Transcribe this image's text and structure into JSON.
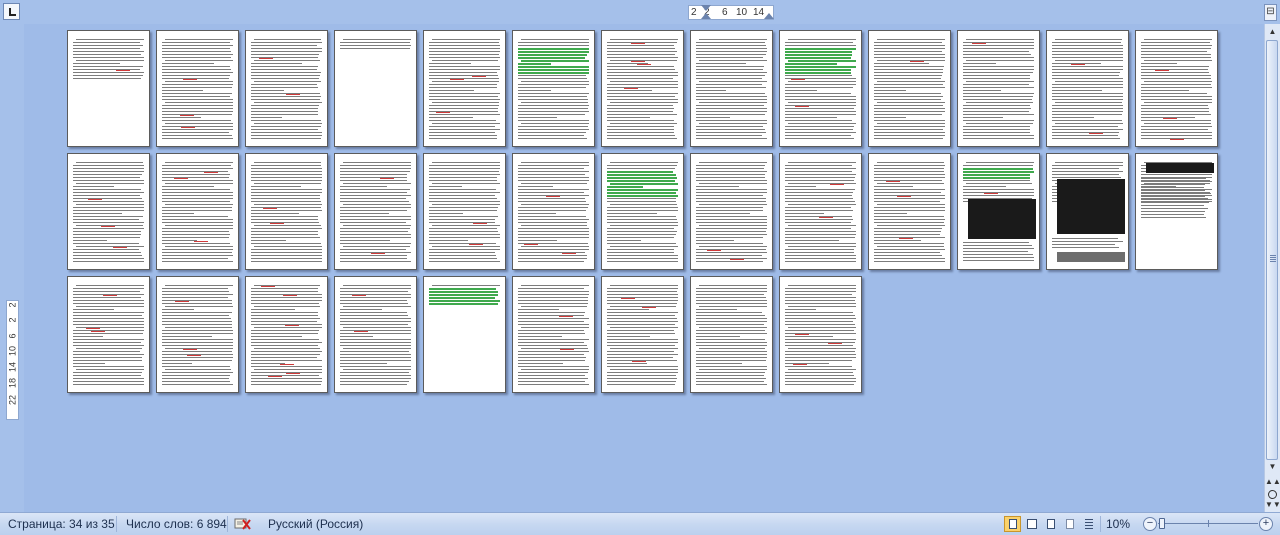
{
  "status_bar": {
    "page_label": "Страница: 34 из 35",
    "word_count_label": "Число слов: 6 894",
    "language_label": "Русский (Россия)",
    "zoom_label": "10%",
    "zoom_out_symbol": "−",
    "zoom_in_symbol": "+",
    "zoom_percent": 10,
    "active_view": "print-layout"
  },
  "horizontal_ruler": {
    "ticks": [
      "2",
      "2",
      "6",
      "10",
      "14"
    ]
  },
  "vertical_ruler": {
    "ticks": [
      "2",
      "2",
      "6",
      "10",
      "14",
      "18",
      "22"
    ]
  },
  "scrollbar": {
    "up_symbol": "▲",
    "down_symbol": "▼",
    "prev_symbol": "▲▲",
    "next_symbol": "▼▼"
  },
  "view_ruler_symbol": "⊟",
  "document": {
    "page_count": 35,
    "current_page": 34,
    "page_kinds": [
      "toc",
      "text",
      "text",
      "blank-ish",
      "text",
      "green",
      "text",
      "text",
      "green",
      "text",
      "text",
      "text",
      "text",
      "text",
      "text",
      "text",
      "text",
      "text",
      "text",
      "green",
      "text",
      "text",
      "text",
      "table",
      "table",
      "table",
      "text",
      "text",
      "text",
      "text",
      "green-top",
      "text",
      "text",
      "text",
      "text"
    ]
  },
  "colors": {
    "background": "#9fbbe8",
    "status_bar": "#c7d8f1",
    "green_highlight": "#3fa94d",
    "spell_error": "#d03a3a"
  }
}
